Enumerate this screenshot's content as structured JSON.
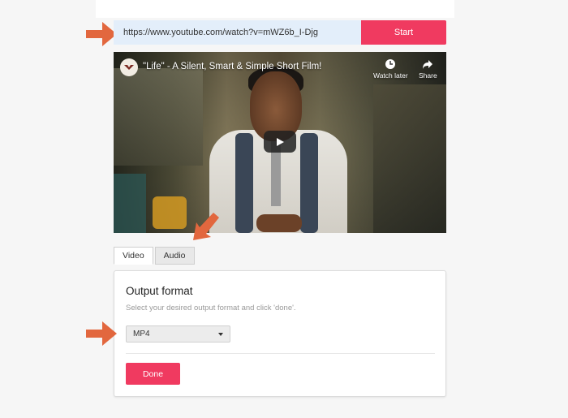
{
  "url_bar": {
    "value": "https://www.youtube.com/watch?v=mWZ6b_I-Djg",
    "start_label": "Start"
  },
  "video": {
    "title": "\"Life\" - A Silent, Smart & Simple Short Film!",
    "watch_later_label": "Watch later",
    "share_label": "Share"
  },
  "tabs": [
    {
      "label": "Video",
      "active": true
    },
    {
      "label": "Audio",
      "active": false
    }
  ],
  "panel": {
    "title": "Output format",
    "hint": "Select your desired output format and click 'done'.",
    "format_selected": "MP4",
    "done_label": "Done"
  },
  "colors": {
    "accent": "#f03a60",
    "annotation_arrow": "#e2673e",
    "input_bg": "#e3eefa"
  },
  "icons": [
    "arrow-annotation-icon",
    "clock-icon",
    "share-icon",
    "play-icon",
    "channel-logo-icon",
    "caret-down-icon"
  ]
}
